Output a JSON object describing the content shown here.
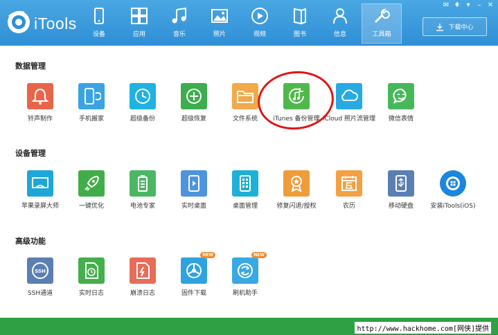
{
  "app": {
    "title": "iTools"
  },
  "nav": {
    "items": [
      {
        "label": "设备",
        "icon": "phone-icon"
      },
      {
        "label": "应用",
        "icon": "apps-icon"
      },
      {
        "label": "音乐",
        "icon": "music-icon"
      },
      {
        "label": "照片",
        "icon": "photo-icon"
      },
      {
        "label": "视频",
        "icon": "video-icon"
      },
      {
        "label": "图书",
        "icon": "book-icon"
      },
      {
        "label": "信息",
        "icon": "user-icon"
      },
      {
        "label": "工具箱",
        "icon": "tools-icon",
        "active": true
      }
    ],
    "download_center": "下载中心"
  },
  "sections": [
    {
      "title": "数据管理",
      "tiles": [
        {
          "label": "铃声制作",
          "icon": "bell-icon",
          "color": "#e8654a"
        },
        {
          "label": "手机搬家",
          "icon": "phone-transfer-icon",
          "color": "#39a3e4"
        },
        {
          "label": "超级备份",
          "icon": "clock-backup-icon",
          "color": "#1fb2e2"
        },
        {
          "label": "超级恢复",
          "icon": "restore-icon",
          "color": "#3cae4e"
        },
        {
          "label": "文件系统",
          "icon": "folder-icon",
          "color": "#f1a94a"
        },
        {
          "label": "iTunes 备份管理",
          "icon": "itunes-backup-icon",
          "color": "#4fb84a"
        },
        {
          "label": "iCloud 照片流管理",
          "icon": "cloud-icon",
          "color": "#27a9e4"
        },
        {
          "label": "微信表情",
          "icon": "wechat-emoji-icon",
          "color": "#47b85a"
        }
      ]
    },
    {
      "title": "设备管理",
      "tiles": [
        {
          "label": "苹果录屏大师",
          "icon": "screen-record-icon",
          "color": "#1ea6d9"
        },
        {
          "label": "一键优化",
          "icon": "rocket-icon",
          "color": "#40ad4a"
        },
        {
          "label": "电池专家",
          "icon": "battery-icon",
          "color": "#4cb763"
        },
        {
          "label": "实时桌面",
          "icon": "live-desktop-icon",
          "color": "#4d93dd"
        },
        {
          "label": "桌面管理",
          "icon": "desktop-manage-icon",
          "color": "#1fb0d6"
        },
        {
          "label": "修复闪退/授权",
          "icon": "repair-icon",
          "color": "#ef9c3c"
        },
        {
          "label": "农历",
          "icon": "calendar-icon",
          "color": "#f3a144"
        },
        {
          "label": "移动硬盘",
          "icon": "usb-drive-icon",
          "color": "#5a7fb3"
        },
        {
          "label": "安装iTools(iOS)",
          "icon": "itools-install-icon",
          "color": "#1b86dd"
        }
      ]
    },
    {
      "title": "高级功能",
      "tiles": [
        {
          "label": "SSH通道",
          "icon": "ssh-icon",
          "color": "#5a7fb3"
        },
        {
          "label": "实时日志",
          "icon": "log-icon",
          "color": "#43b04c"
        },
        {
          "label": "崩溃日志",
          "icon": "crash-log-icon",
          "color": "#e76c5a"
        },
        {
          "label": "固件下载",
          "icon": "firmware-icon",
          "color": "#2ea3e0",
          "badge": "NEW"
        },
        {
          "label": "刷机助手",
          "icon": "flash-icon",
          "color": "#3aa8e4",
          "badge": "NEW"
        }
      ]
    }
  ],
  "footer": {
    "watermark": "http://www.hackhome.com[网侠]提供"
  }
}
